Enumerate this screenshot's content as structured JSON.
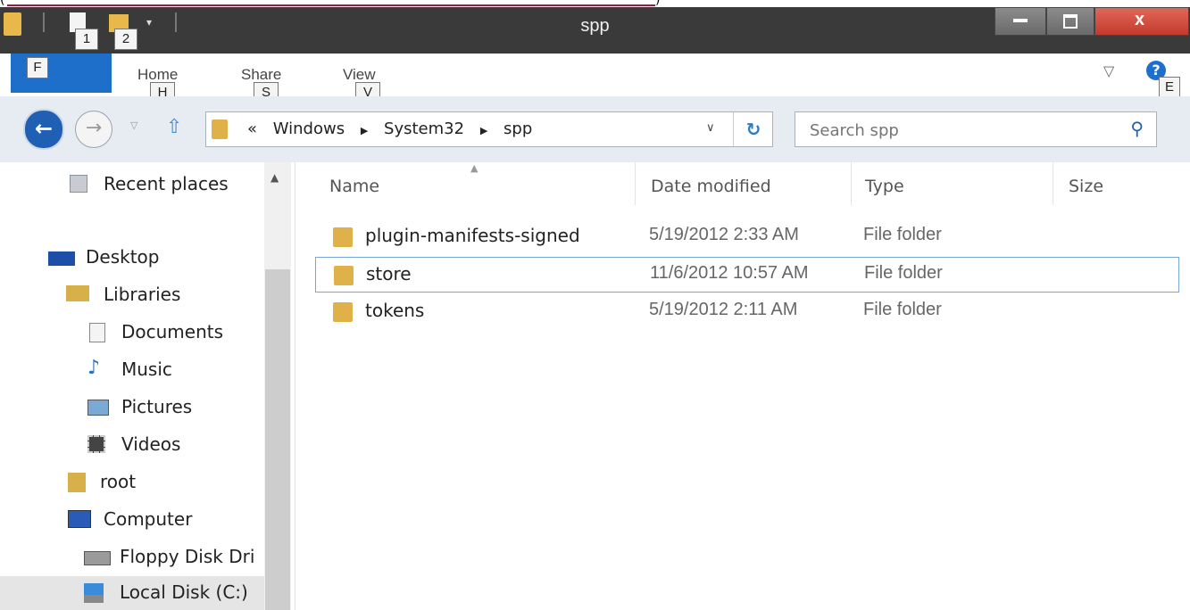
{
  "window": {
    "title": "spp"
  },
  "quick_access": {
    "keytips": [
      "1",
      "2"
    ]
  },
  "ribbon": {
    "file_keytip": "F",
    "tabs": [
      {
        "label": "Home",
        "keytip": "H"
      },
      {
        "label": "Share",
        "keytip": "S"
      },
      {
        "label": "View",
        "keytip": "V"
      }
    ],
    "help_keytip": "E"
  },
  "address": {
    "prefix": "«",
    "crumbs": [
      "Windows",
      "System32",
      "spp"
    ],
    "separator": "▶"
  },
  "search": {
    "placeholder": "Search spp"
  },
  "nav_pane": {
    "items": [
      {
        "label": "Recent places",
        "icon": "recent-places-icon"
      },
      {
        "label": "Desktop",
        "icon": "desktop-icon"
      },
      {
        "label": "Libraries",
        "icon": "libraries-icon"
      },
      {
        "label": "Documents",
        "icon": "documents-icon"
      },
      {
        "label": "Music",
        "icon": "music-icon"
      },
      {
        "label": "Pictures",
        "icon": "pictures-icon"
      },
      {
        "label": "Videos",
        "icon": "videos-icon"
      },
      {
        "label": "root",
        "icon": "user-folder-icon"
      },
      {
        "label": "Computer",
        "icon": "computer-icon"
      },
      {
        "label": "Floppy Disk Dri",
        "icon": "floppy-drive-icon"
      },
      {
        "label": "Local Disk (C:)",
        "icon": "local-disk-icon"
      }
    ]
  },
  "columns": {
    "name": "Name",
    "date": "Date modified",
    "type": "Type",
    "size": "Size"
  },
  "files": [
    {
      "name": "plugin-manifests-signed",
      "date": "5/19/2012 2:33 AM",
      "type": "File folder"
    },
    {
      "name": "store",
      "date": "11/6/2012 10:57 AM",
      "type": "File folder"
    },
    {
      "name": "tokens",
      "date": "5/19/2012 2:11 AM",
      "type": "File folder"
    }
  ],
  "colors": {
    "accent": "#1e6fc9",
    "titlebar": "#3a3a3a",
    "close": "#c33b2c",
    "folder": "#e0b049"
  }
}
